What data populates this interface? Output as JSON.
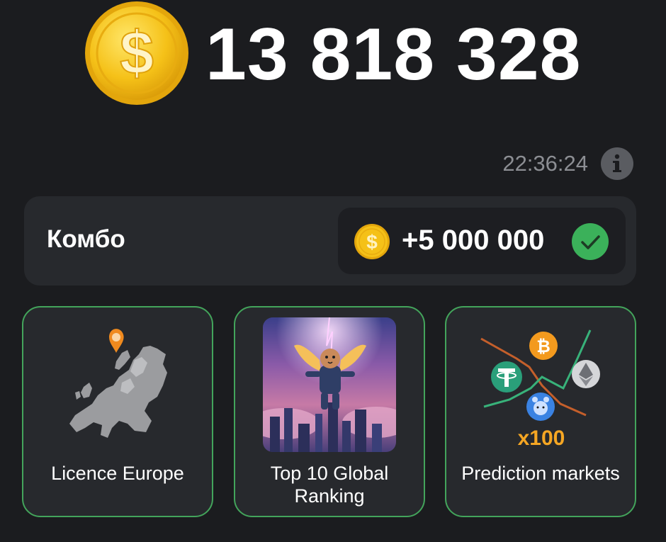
{
  "balance": {
    "value": "13 818 328",
    "coin_icon": "dollar-coin-icon"
  },
  "timer": {
    "value": "22:36:24",
    "info_icon": "info-icon"
  },
  "combo": {
    "title": "Комбо",
    "reward": "+5 000 000",
    "coin_icon": "dollar-coin-icon",
    "status_icon": "check-icon"
  },
  "cards": [
    {
      "label": "Licence Europe",
      "icon": "europe-map-icon"
    },
    {
      "label_line1": "Top 10 Global",
      "label_line2": "Ranking",
      "icon": "hamster-astronaut-image"
    },
    {
      "label": "Prediction markets",
      "badge": "x100",
      "icon": "crypto-chart-icon"
    }
  ],
  "colors": {
    "background": "#1b1c1f",
    "card": "#27292d",
    "card_border": "#43a45b",
    "coin": "#f5c118",
    "check": "#3bb15a",
    "badge": "#f5a623"
  }
}
